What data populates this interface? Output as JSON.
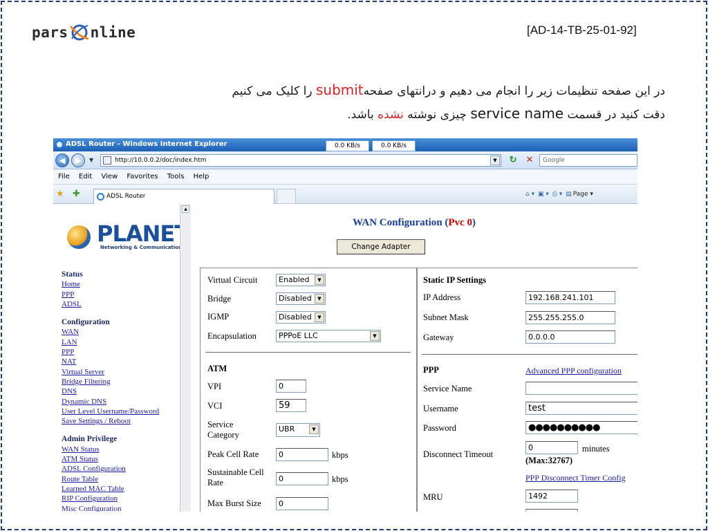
{
  "slide": {
    "logo_left": "pars",
    "logo_right": "nline",
    "id_label": "[AD-14-TB-25-01-92]",
    "line1_part1": "در این صفحه تنظیمات زیر را انجام می دهیم و درانتهای صفحه",
    "line1_submit": "submit",
    "line1_part2": "را کلیک می کنیم",
    "line2_part1": "دقت کنید در قسمت",
    "line2_service": "service name",
    "line2_part2": "چیزی نوشته",
    "line2_red": "نشده",
    "line2_part3": "باشد."
  },
  "browser": {
    "title": "ADSL Router - Windows Internet Explorer",
    "speed1": "0.0 KB/s",
    "speed2": "0.0 KB/s",
    "address": "http://10.0.0.2/doc/index.htm",
    "search_placeholder": "Google",
    "menu": [
      "File",
      "Edit",
      "View",
      "Favorites",
      "Tools",
      "Help"
    ],
    "tab_label": "ADSL Router",
    "page_label": "Page"
  },
  "logo": {
    "brand": "PLANET",
    "tagline": "Networking & Communication"
  },
  "nav": {
    "status_heading": "Status",
    "status_items": [
      "Home",
      "PPP",
      "ADSL"
    ],
    "config_heading": "Configuration",
    "config_items": [
      "WAN",
      "LAN",
      "PPP",
      "NAT",
      "Virtual Server",
      "Bridge Filtering",
      "DNS",
      "Dynamic DNS",
      "User Level Username/Password",
      "Save Settings / Reboot"
    ],
    "admin_heading": "Admin Privilege",
    "admin_items": [
      "WAN Status",
      "ATM Status",
      "ADSL Configuration",
      "Route Table",
      "Learned MAC Table",
      "RIP Configuration",
      "Misc Configuration"
    ]
  },
  "main": {
    "title": "WAN Configuration (",
    "title_pvc": "Pvc 0",
    "title_close": ")",
    "change_adapter": "Change Adapter",
    "virtual_circuit_label": "Virtual Circuit",
    "virtual_circuit_value": "Enabled",
    "bridge_label": "Bridge",
    "bridge_value": "Disabled",
    "igmp_label": "IGMP",
    "igmp_value": "Disabled",
    "encap_label": "Encapsulation",
    "encap_value": "PPPoE LLC",
    "atm_heading": "ATM",
    "vpi_label": "VPI",
    "vpi_value": "0",
    "vci_label": "VCI",
    "vci_value": "59",
    "service_cat_label1": "Service",
    "service_cat_label2": "Category",
    "service_cat_value": "UBR",
    "pcr_label": "Peak Cell Rate",
    "pcr_value": "0",
    "pcr_unit": "kbps",
    "scr_label1": "Sustainable Cell",
    "scr_label2": "Rate",
    "scr_value": "0",
    "scr_unit": "kbps",
    "mbs_label": "Max Burst Size",
    "mbs_value": "0",
    "static_ip_heading": "Static IP Settings",
    "ip_label": "IP Address",
    "ip_value": "192.168.241.101",
    "mask_label": "Subnet Mask",
    "mask_value": "255.255.255.0",
    "gw_label": "Gateway",
    "gw_value": "0.0.0.0",
    "ppp_heading": "PPP",
    "adv_ppp_link": "Advanced PPP configuration",
    "service_name_label": "Service Name",
    "service_name_value": "",
    "username_label": "Username",
    "username_value": "test",
    "password_label": "Password",
    "password_value": "●●●●●●●●●●",
    "disc_timeout_label": "Disconnect Timeout",
    "disc_timeout_value": "0",
    "disc_timeout_unit": "minutes",
    "disc_timeout_max": "(Max:32767)",
    "timer_link": "PPP Disconnect Timer Config",
    "mru_label": "MRU",
    "mru_value": "1492"
  }
}
